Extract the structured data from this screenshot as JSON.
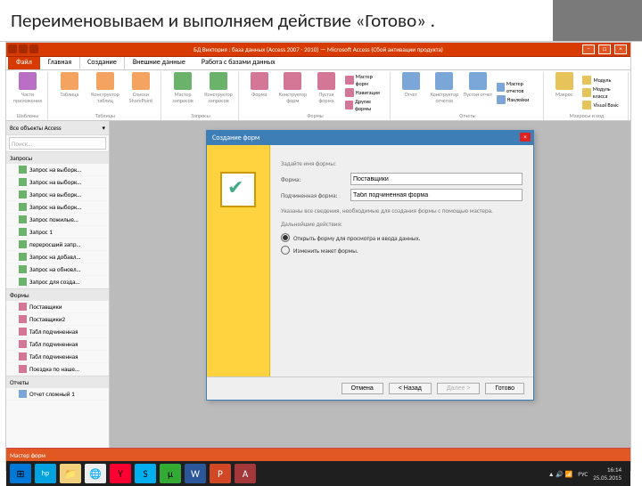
{
  "slide": {
    "title": "Переименовываем и выполняем действие «Готово» ."
  },
  "titlebar": {
    "text": "БД Виктория : база данных (Access 2007 - 2010) — Microsoft Access (Сбой активации продукта)"
  },
  "tabs": {
    "file": "Файл",
    "t1": "Главная",
    "t2": "Создание",
    "t3": "Внешние данные",
    "t4": "Работа с базами данных"
  },
  "ribbon": {
    "g1_items": [
      {
        "lbl": "Части приложения"
      }
    ],
    "g2_items": [
      {
        "lbl": "Таблица"
      },
      {
        "lbl": "Конструктор таблиц"
      },
      {
        "lbl": "Списки SharePoint"
      }
    ],
    "g3_items": [
      {
        "lbl": "Мастер запросов"
      },
      {
        "lbl": "Конструктор запросов"
      }
    ],
    "g4_items": [
      {
        "lbl": "Форма"
      },
      {
        "lbl": "Конструктор форм"
      },
      {
        "lbl": "Пустая форма"
      }
    ],
    "g4_small": {
      "a": "Мастер форм",
      "b": "Навигация",
      "c": "Другие формы"
    },
    "g5_items": [
      {
        "lbl": "Отчет"
      },
      {
        "lbl": "Конструктор отчетов"
      },
      {
        "lbl": "Пустой отчет"
      }
    ],
    "g5_small": {
      "a": "Мастер отчетов",
      "b": "Наклейки"
    },
    "g6_small": {
      "a": "Модуль",
      "b": "Модуль класса",
      "c": "Visual Basic"
    },
    "labels": {
      "g1": "Шаблоны",
      "g2": "Таблицы",
      "g3": "Запросы",
      "g4": "Формы",
      "g5": "Отчеты",
      "g6": "Макросы и код"
    }
  },
  "nav": {
    "header": "Все объекты Access",
    "search": "Поиск...",
    "sect_q": "Запросы",
    "queries": [
      "Запрос на выборк…",
      "Запрос на выборк…",
      "Запрос на выборк…",
      "Запрос на выборк…",
      "Запрос пожилые…",
      "Запрос 1",
      "переросший запр…",
      "Запрос на добавл…",
      "Запрос на обновл…",
      "Запрос для созда…"
    ],
    "sect_f": "Формы",
    "forms": [
      "Поставщики",
      "Поставщики2",
      "Табл подчиненная",
      "Табл подчиненная",
      "Табл подчиненная",
      "Поездка по наше…"
    ],
    "sect_r": "Отчеты",
    "reports": [
      "Отчет сложный 1"
    ]
  },
  "wizard": {
    "title": "Создание форм",
    "intro": "Задайте имя формы:",
    "form_lbl": "Форма:",
    "form_val": "Поставщики",
    "sub_lbl": "Подчиненная форма:",
    "sub_val": "Табл подчиненная форма",
    "hint1": "Указаны все сведения, необходимые для создания формы с помощью мастера.",
    "hint2": "Дальнейшие действия:",
    "opt1": "Открыть форму для просмотра и ввода данных.",
    "opt2": "Изменить макет формы.",
    "btn_cancel": "Отмена",
    "btn_back": "< Назад",
    "btn_next": "Далее >",
    "btn_finish": "Готово"
  },
  "tray": {
    "lang": "РУС",
    "time": "16:14",
    "date": "25.05.2015"
  },
  "footer": {
    "text": "Мастер форм"
  },
  "colors": {
    "tbl": "#f4a460",
    "qry": "#6bb36b",
    "frm": "#d47796",
    "rpt": "#7aa6d8",
    "mod": "#e6c45a",
    "app": "#b86fc4"
  }
}
